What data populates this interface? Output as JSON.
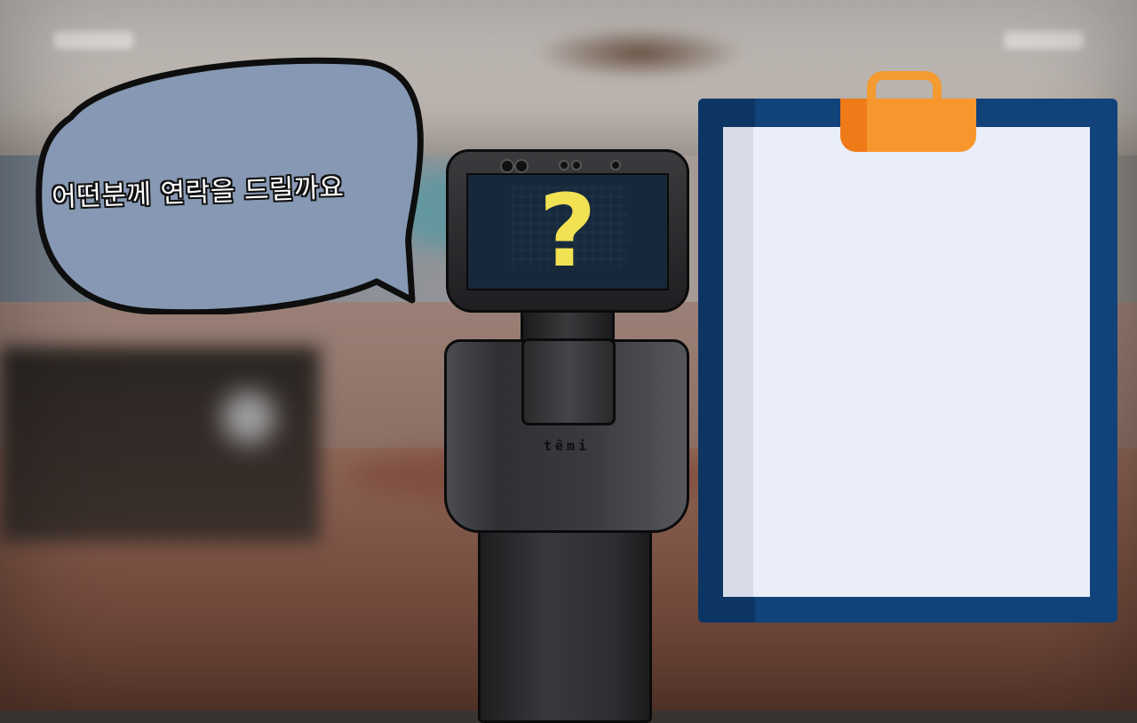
{
  "speech_bubble": {
    "text": "어떤분께 연락을 드릴까요"
  },
  "robot": {
    "screen_symbol": "?",
    "brand_logo": "têmi"
  },
  "clipboard": {
    "paper_text": ""
  },
  "colors": {
    "bubble_fill": "#8698b3",
    "question_mark": "#f1e253",
    "clipboard_frame": "#12427a",
    "clipboard_paper": "#e9eef9",
    "clip": "#f7962d"
  },
  "icons": [
    "speech-bubble-icon",
    "question-mark-icon",
    "clipboard-icon"
  ]
}
